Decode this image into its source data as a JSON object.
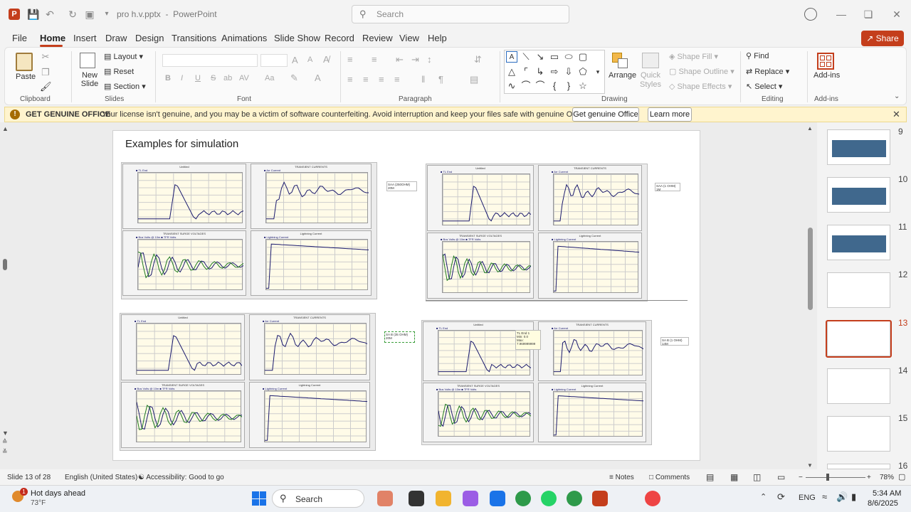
{
  "titlebar": {
    "app_icon": "P",
    "doc_title": "pro h.v.pptx",
    "app_name": "PowerPoint",
    "search_placeholder": "Search"
  },
  "menu": {
    "tabs": [
      "File",
      "Home",
      "Insert",
      "Draw",
      "Design",
      "Transitions",
      "Animations",
      "Slide Show",
      "Record",
      "Review",
      "View",
      "Help"
    ],
    "active": "Home",
    "share_label": "Share"
  },
  "ribbon": {
    "clipboard": {
      "paste": "Paste",
      "label": "Clipboard"
    },
    "slides": {
      "new_slide": "New Slide",
      "layout": "Layout",
      "reset": "Reset",
      "section": "Section",
      "label": "Slides"
    },
    "font": {
      "label": "Font",
      "bold": "B",
      "italic": "I",
      "underline": "U",
      "strike": "S",
      "shadow": "ab",
      "spacing": "AV",
      "case": "Aa",
      "grow": "A",
      "shrink": "A"
    },
    "paragraph": {
      "label": "Paragraph"
    },
    "drawing": {
      "arrange": "Arrange",
      "quick_styles": "Quick Styles",
      "shape_fill": "Shape Fill",
      "shape_outline": "Shape Outline",
      "shape_effects": "Shape Effects",
      "label": "Drawing"
    },
    "editing": {
      "find": "Find",
      "replace": "Replace",
      "select": "Select",
      "label": "Editing"
    },
    "addins": {
      "addins": "Add-ins",
      "label": "Add-ins"
    }
  },
  "message_bar": {
    "title": "GET GENUINE OFFICE",
    "text": "Your license isn't genuine, and you may be a victim of software counterfeiting. Avoid interruption and keep your files safe with genuine Office today.",
    "btn_primary": "Get genuine Office",
    "btn_secondary": "Learn more"
  },
  "slide": {
    "title": "Examples for simulation",
    "chart_titles": {
      "untitled": "Untitled",
      "currents": "TRANSIENT CURRENTS",
      "voltages": "TRANSIENT SURGE VOLTAGES",
      "lightning": "Lightning Current"
    },
    "legend": {
      "tl_end": "TL End",
      "arr_current": "Arr Current",
      "bus_volts": "Bus Volts @ 10m",
      "tfr_volts": "TFR Volts",
      "lightning_current": "Lightning Current"
    },
    "notes": [
      "SAA (250OHM) 20M",
      "SAA (1 OHM) 1M",
      "SA B (35 OHM) 20M",
      "SA B (1 OHM) 14M"
    ],
    "tooltip": [
      "TL End 1",
      "Min: 0.0",
      "Max: 7.969999999"
    ]
  },
  "thumbnails": {
    "numbers": [
      "9",
      "10",
      "11",
      "12",
      "13",
      "14",
      "15",
      "16"
    ],
    "selected": "13"
  },
  "statusbar": {
    "slide_info": "Slide 13 of 28",
    "language": "English (United States)",
    "accessibility": "Accessibility: Good to go",
    "notes": "Notes",
    "comments": "Comments",
    "zoom": "78%"
  },
  "taskbar": {
    "weather_title": "Hot days ahead",
    "weather_temp": "73°F",
    "weather_badge": "1",
    "search": "Search",
    "lang": "ENG",
    "time": "5:34 AM",
    "date": "8/6/2025"
  },
  "colors": {
    "accent": "#c43e1c",
    "series_blue": "#1a1a6e",
    "series_green": "#1f7a1f"
  }
}
